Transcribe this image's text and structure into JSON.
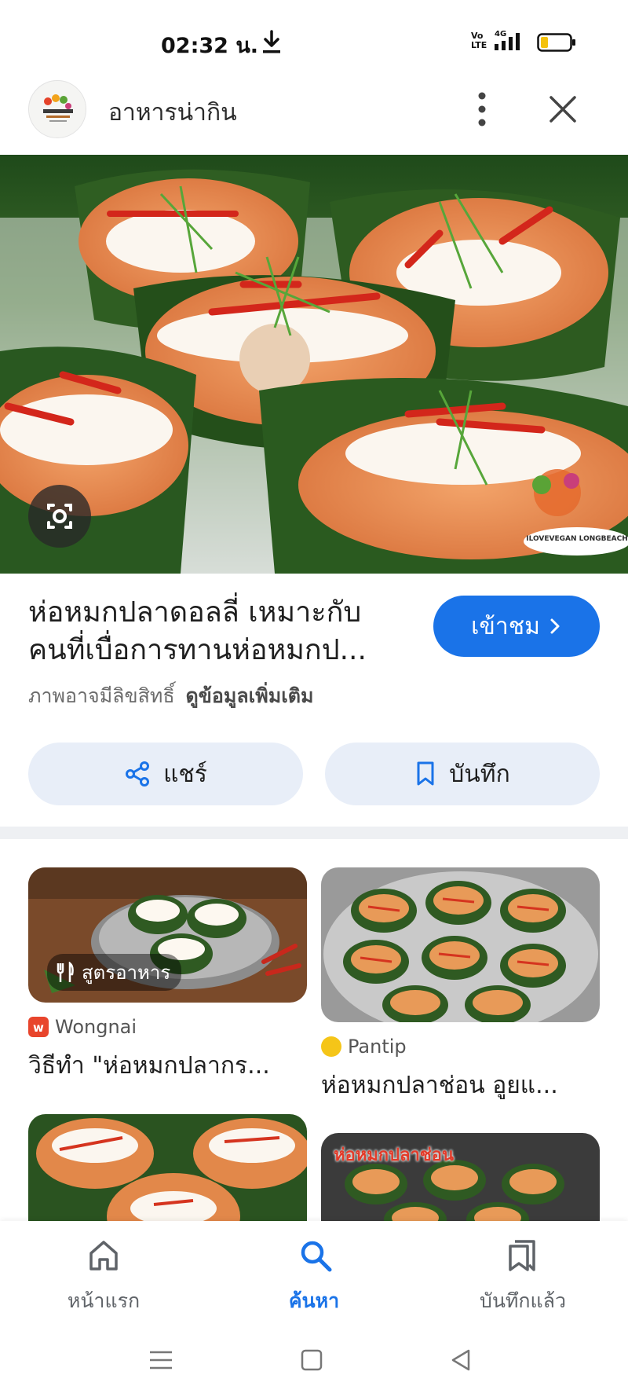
{
  "status_bar": {
    "time": "02:32 น.",
    "network": "4G",
    "volte": "Vo LTE"
  },
  "header": {
    "title": "อาหารน่ากิน"
  },
  "hero": {
    "watermark": "ILOVEVEGAN LONGBEACH"
  },
  "caption": {
    "title": "ห่อหมกปลาดอลลี่ เหมาะกับคนที่เบื่อการทานห่อหมกป...",
    "visit_label": "เข้าชม",
    "copyright": "ภาพอาจมีลิขสิทธิ์",
    "more_info": "ดูข้อมูลเพิ่มเติม"
  },
  "actions": {
    "share_label": "แชร์",
    "save_label": "บันทึก"
  },
  "results": [
    {
      "tag": "สูตรอาหาร",
      "source": "Wongnai",
      "title": "วิธีทำ \"ห่อหมกปลากร..."
    },
    {
      "source": "Pantip",
      "title": "ห่อหมกปลาช่อน อูยแ..."
    }
  ],
  "result_overlay_text": "ห่อหมกปลาช่อน",
  "bottom_nav": [
    {
      "label": "หน้าแรก",
      "icon": "home-icon"
    },
    {
      "label": "ค้นหา",
      "icon": "search-icon",
      "active": true
    },
    {
      "label": "บันทึกแล้ว",
      "icon": "bookmarks-icon"
    }
  ],
  "colors": {
    "accent": "#1a73e8",
    "chip_bg": "#e8eef8"
  }
}
